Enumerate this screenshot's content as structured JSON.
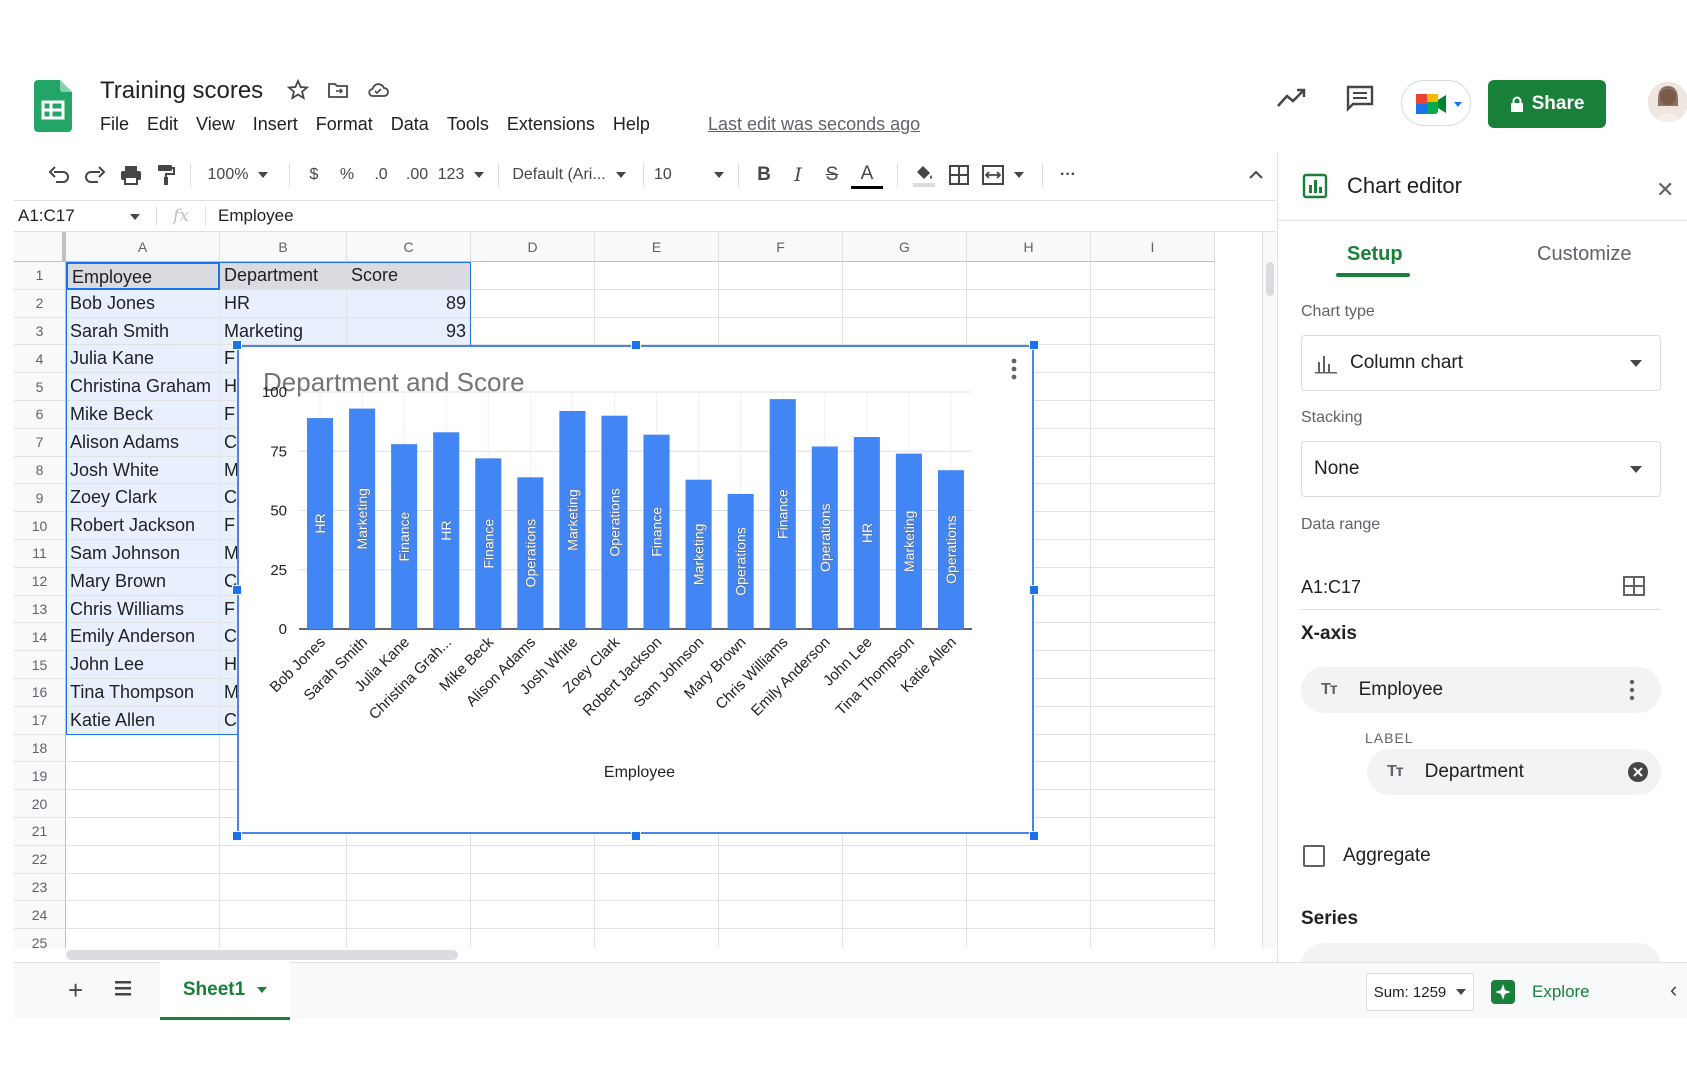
{
  "doc": {
    "title": "Training scores",
    "last_edit": "Last edit was seconds ago",
    "share_label": "Share"
  },
  "menu": [
    "File",
    "Edit",
    "View",
    "Insert",
    "Format",
    "Data",
    "Tools",
    "Extensions",
    "Help"
  ],
  "toolbar": {
    "zoom": "100%",
    "currency": "$",
    "percent": "%",
    "dec_decrease": ".0",
    "dec_increase": ".00",
    "more_formats": "123",
    "font": "Default (Ari...",
    "font_size": "10",
    "bold": "B",
    "italic": "I",
    "strike": "S",
    "text_color": "A",
    "more": "···"
  },
  "formula": {
    "name_box": "A1:C17",
    "fx": "fx",
    "value": "Employee"
  },
  "columns": [
    "A",
    "B",
    "C",
    "D",
    "E",
    "F",
    "G",
    "H",
    "I"
  ],
  "rows": [
    "1",
    "2",
    "3",
    "4",
    "5",
    "6",
    "7",
    "8",
    "9",
    "10",
    "11",
    "12",
    "13",
    "14",
    "15",
    "16",
    "17",
    "18",
    "19",
    "20",
    "21",
    "22",
    "23",
    "24",
    "25"
  ],
  "table": {
    "headers": [
      "Employee",
      "Department",
      "Score"
    ],
    "employees": [
      "Bob Jones",
      "Sarah Smith",
      "Julia Kane",
      "Christina Graham",
      "Mike Beck",
      "Alison Adams",
      "Josh White",
      "Zoey Clark",
      "Robert Jackson",
      "Sam Johnson",
      "Mary Brown",
      "Chris Williams",
      "Emily Anderson",
      "John Lee",
      "Tina Thompson",
      "Katie Allen"
    ],
    "departments_visible": [
      "HR",
      "Marketing",
      "F",
      "H",
      "F",
      "C",
      "M",
      "C",
      "F",
      "M",
      "C",
      "F",
      "C",
      "H",
      "M",
      "C"
    ],
    "scores_visible": [
      "89",
      "93"
    ]
  },
  "chart_data": {
    "type": "bar",
    "title": "Department  and Score",
    "xlabel": "Employee",
    "ylabel": "",
    "ylim": [
      0,
      100
    ],
    "yticks": [
      "0",
      "25",
      "50",
      "75",
      "100"
    ],
    "grid": true,
    "categories": [
      "Bob Jones",
      "Sarah Smith",
      "Julia Kane",
      "Christina Grah...",
      "Mike Beck",
      "Alison Adams",
      "Josh White",
      "Zoey Clark",
      "Robert Jackson",
      "Sam Johnson",
      "Mary Brown",
      "Chris Williams",
      "Emily Anderson",
      "John Lee",
      "Tina Thompson",
      "Katie Allen"
    ],
    "values": [
      89,
      93,
      78,
      83,
      72,
      64,
      92,
      90,
      82,
      63,
      57,
      97,
      77,
      81,
      74,
      67
    ],
    "bar_labels": [
      "HR",
      "Marketing",
      "Finance",
      "HR",
      "Finance",
      "Operations",
      "Marketing",
      "Operations",
      "Finance",
      "Marketing",
      "Operations",
      "Finance",
      "Operations",
      "HR",
      "Marketing",
      "Operations"
    ],
    "bar_color": "#4285f4"
  },
  "bottom": {
    "sheet_name": "Sheet1",
    "sum": "Sum: 1259",
    "explore": "Explore"
  },
  "editor": {
    "title": "Chart editor",
    "tab_setup": "Setup",
    "tab_customize": "Customize",
    "chart_type_label": "Chart type",
    "chart_type_value": "Column chart",
    "stacking_label": "Stacking",
    "stacking_value": "None",
    "data_range_label": "Data range",
    "data_range_value": "A1:C17",
    "xaxis_label": "X-axis",
    "xaxis_chip": "Employee",
    "label_caption": "LABEL",
    "label_chip": "Department",
    "aggregate_label": "Aggregate",
    "series_label": "Series"
  },
  "colors": {
    "brand_green": "#188038",
    "selection_blue": "#1a73e8",
    "bar_blue": "#4285f4"
  }
}
